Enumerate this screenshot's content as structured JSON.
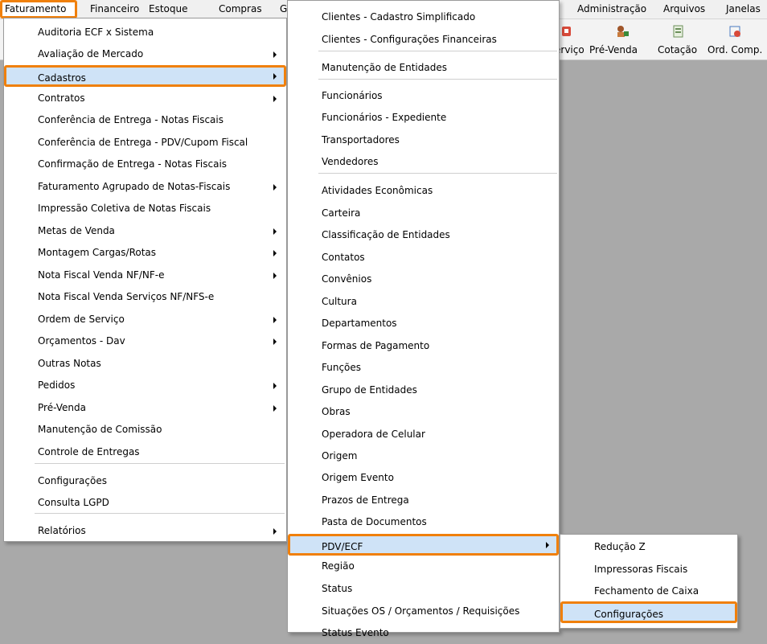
{
  "colors": {
    "highlight": "#f0800c",
    "selection": "#cfe3f7",
    "background": "#a9a9a9"
  },
  "menubar": {
    "items": [
      "Faturamento",
      "Financeiro",
      "Estoque",
      "Compras",
      "G",
      "Administração",
      "Arquivos",
      "Janelas"
    ]
  },
  "toolbar": {
    "buttons": [
      {
        "label": "erviço",
        "icon": "service-order-icon"
      },
      {
        "label": "Pré-Venda",
        "icon": "pre-sale-icon"
      },
      {
        "label": "Cotação",
        "icon": "quotation-icon"
      },
      {
        "label": "Ord. Comp.",
        "icon": "purchase-order-icon"
      }
    ]
  },
  "faturamento_menu": {
    "items": [
      "Auditoria ECF x Sistema",
      "Avaliação de Mercado",
      "Cadastros",
      "Contratos",
      "Conferência de Entrega - Notas Fiscais",
      "Conferência de Entrega - PDV/Cupom Fiscal",
      "Confirmação de Entrega - Notas Fiscais",
      "Faturamento Agrupado de Notas-Fiscais",
      "Impressão Coletiva de Notas Fiscais",
      "Metas de Venda",
      "Montagem Cargas/Rotas",
      "Nota Fiscal Venda NF/NF-e",
      "Nota Fiscal Venda Serviços NF/NFS-e",
      "Ordem de Serviço",
      "Orçamentos - Dav",
      "Outras Notas",
      "Pedidos",
      "Pré-Venda",
      "Manutenção de Comissão",
      "Controle de Entregas",
      "Configurações",
      "Consulta LGPD",
      "Relatórios"
    ]
  },
  "cadastros_menu": {
    "items": [
      "Clientes - Cadastro Simplificado",
      "Clientes - Configurações Financeiras",
      "Manutenção de Entidades",
      "Funcionários",
      "Funcionários - Expediente",
      "Transportadores",
      "Vendedores",
      "Atividades Econômicas",
      "Carteira",
      "Classificação de Entidades",
      "Contatos",
      "Convênios",
      "Cultura",
      "Departamentos",
      "Formas de Pagamento",
      "Funções",
      "Grupo de Entidades",
      "Obras",
      "Operadora de Celular",
      "Origem",
      "Origem Evento",
      "Prazos de Entrega",
      "Pasta de Documentos",
      "PDV/ECF",
      "Região",
      "Status",
      "Situações OS / Orçamentos / Requisições",
      "Status Evento"
    ]
  },
  "pdv_menu": {
    "items": [
      "Redução Z",
      "Impressoras Fiscais",
      "Fechamento de Caixa",
      "Configurações"
    ]
  }
}
